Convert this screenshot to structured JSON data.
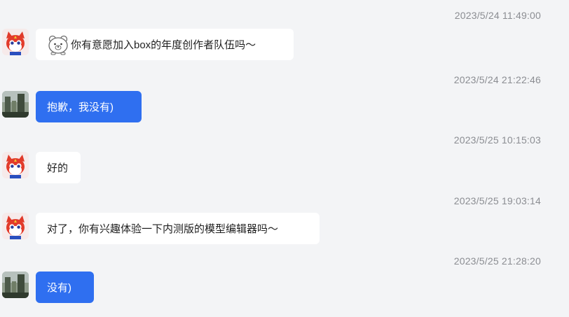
{
  "messages": [
    {
      "time": "2023/5/24 11:49:00",
      "sender": "bot",
      "text": "你有意愿加入box的年度创作者队伍吗～",
      "sticker": "bear-sticker-icon"
    },
    {
      "time": "2023/5/24 21:22:46",
      "sender": "user",
      "text": "抱歉，我没有)"
    },
    {
      "time": "2023/5/25 10:15:03",
      "sender": "bot",
      "text": "好的"
    },
    {
      "time": "2023/5/25 19:03:14",
      "sender": "bot",
      "text": "对了，你有兴趣体验一下内测版的模型编辑器吗～"
    },
    {
      "time": "2023/5/25 21:28:20",
      "sender": "user",
      "text": "没有)"
    }
  ],
  "colors": {
    "background": "#f3f4f6",
    "incoming_bubble": "#ffffff",
    "outgoing_bubble": "#2f6ff0",
    "timestamp": "#8b8d92"
  }
}
